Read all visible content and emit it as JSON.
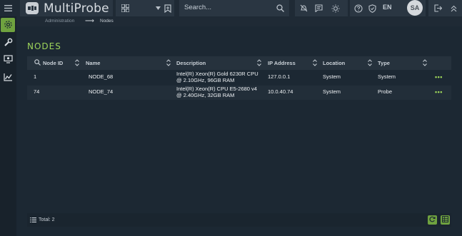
{
  "app": {
    "name": "MultiProbe"
  },
  "search": {
    "placeholder": "Search..."
  },
  "header": {
    "language": "EN",
    "avatar_initials": "SA"
  },
  "breadcrumb": {
    "parent": "Administration",
    "separator": "⟶",
    "current": "Nodes"
  },
  "page": {
    "title": "NODES"
  },
  "table": {
    "columns": [
      "Node ID",
      "Name",
      "Description",
      "IP Address",
      "Location",
      "Type"
    ],
    "rows": [
      {
        "node_id": "1",
        "name": "NODE_68",
        "description_line1": "Intel(R) Xeon(R) Gold 6230R CPU",
        "description_line2": "@ 2.10GHz, 96GB RAM",
        "ip": "127.0.0.1",
        "location": "System",
        "type": "System",
        "actions": "•••"
      },
      {
        "node_id": "74",
        "name": "NODE_74",
        "description_line1": "Intel(R) Xeon(R) CPU E5-2680 v4",
        "description_line2": "@ 2.40GHz, 32GB RAM",
        "ip": "10.0.40.74",
        "location": "System",
        "type": "Probe",
        "actions": "•••"
      }
    ]
  },
  "footer": {
    "total_label": "Total: 2"
  },
  "colors": {
    "accent": "#9dd45a",
    "accent_button": "#6fa23f",
    "background": "#1c2833",
    "header": "#26323d"
  },
  "icons": [
    "menu-icon",
    "logo-icon",
    "dashboard-icon",
    "chevron-down-icon",
    "bookmark-icon",
    "search-icon",
    "bell-off-icon",
    "chat-icon",
    "sun-icon",
    "help-icon",
    "shield-icon",
    "logout-icon",
    "collapse-icon",
    "gear-icon",
    "wrench-icon",
    "monitor-icon",
    "chart-icon",
    "sort-icon",
    "list-icon",
    "refresh-icon",
    "export-icon"
  ]
}
